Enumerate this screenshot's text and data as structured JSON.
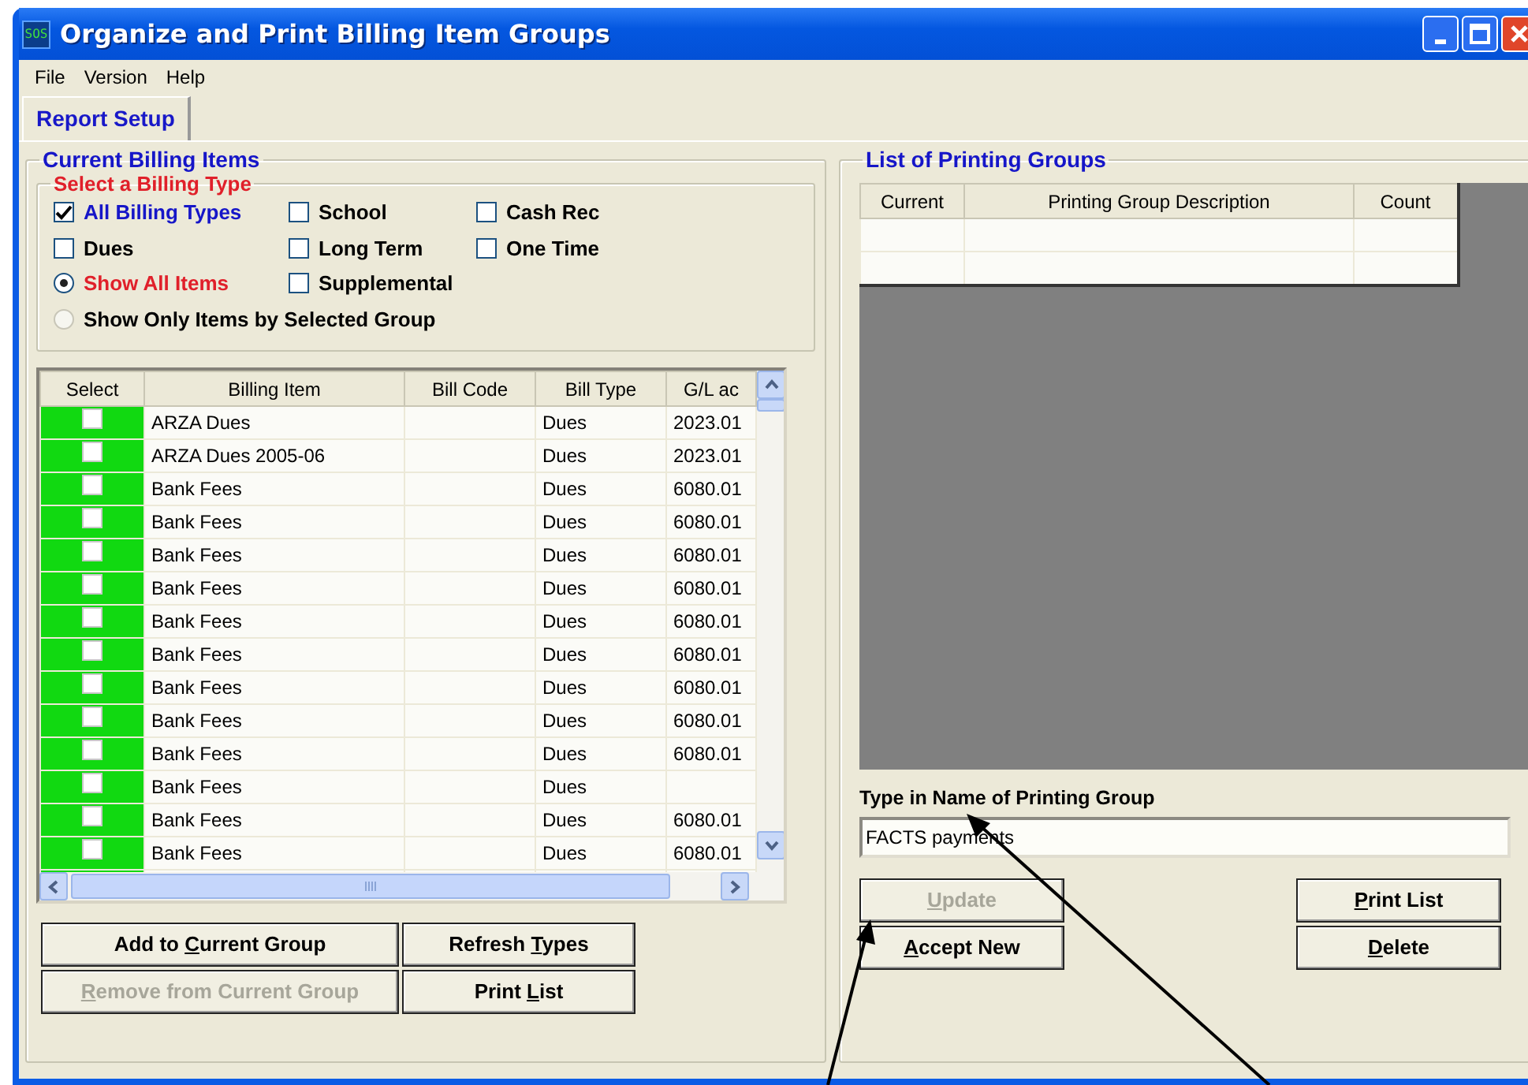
{
  "window": {
    "icon_label": "SOS",
    "title": "Organize and Print Billing Item Groups"
  },
  "menu": [
    "File",
    "Version",
    "Help"
  ],
  "tabs": [
    {
      "label": "Report Setup",
      "selected": true
    }
  ],
  "billing_items": {
    "title": "Current Billing Items",
    "billing_type": {
      "title": "Select a Billing Type",
      "options": [
        {
          "kind": "checkbox",
          "label": "All Billing Types",
          "checked": true
        },
        {
          "kind": "checkbox",
          "label": "School",
          "checked": false
        },
        {
          "kind": "checkbox",
          "label": "Cash Rec",
          "checked": false
        },
        {
          "kind": "checkbox",
          "label": "Dues",
          "checked": false
        },
        {
          "kind": "checkbox",
          "label": "Long Term",
          "checked": false
        },
        {
          "kind": "checkbox",
          "label": "One Time",
          "checked": false
        },
        {
          "kind": "radio",
          "label": "Show All Items",
          "selected": true
        },
        {
          "kind": "checkbox",
          "label": "Supplemental",
          "checked": false
        },
        {
          "kind": "radio",
          "label": "Show Only Items by Selected Group",
          "selected": false
        }
      ]
    },
    "table": {
      "columns": [
        "Select",
        "Billing Item",
        "Bill Code",
        "Bill Type",
        "G/L ac"
      ],
      "rows": [
        {
          "checked": false,
          "billing_item": "ARZA Dues",
          "bill_code": "",
          "bill_type": "Dues",
          "gl": "2023.01"
        },
        {
          "checked": false,
          "billing_item": "ARZA Dues 2005-06",
          "bill_code": "",
          "bill_type": "Dues",
          "gl": "2023.01"
        },
        {
          "checked": false,
          "billing_item": "Bank Fees",
          "bill_code": "",
          "bill_type": "Dues",
          "gl": "6080.01"
        },
        {
          "checked": false,
          "billing_item": "Bank Fees",
          "bill_code": "",
          "bill_type": "Dues",
          "gl": "6080.01"
        },
        {
          "checked": false,
          "billing_item": "Bank Fees",
          "bill_code": "",
          "bill_type": "Dues",
          "gl": "6080.01"
        },
        {
          "checked": false,
          "billing_item": "Bank Fees",
          "bill_code": "",
          "bill_type": "Dues",
          "gl": "6080.01"
        },
        {
          "checked": false,
          "billing_item": "Bank Fees",
          "bill_code": "",
          "bill_type": "Dues",
          "gl": "6080.01"
        },
        {
          "checked": false,
          "billing_item": "Bank Fees",
          "bill_code": "",
          "bill_type": "Dues",
          "gl": "6080.01"
        },
        {
          "checked": false,
          "billing_item": "Bank Fees",
          "bill_code": "",
          "bill_type": "Dues",
          "gl": "6080.01"
        },
        {
          "checked": false,
          "billing_item": "Bank Fees",
          "bill_code": "",
          "bill_type": "Dues",
          "gl": "6080.01"
        },
        {
          "checked": false,
          "billing_item": "Bank Fees",
          "bill_code": "",
          "bill_type": "Dues",
          "gl": "6080.01"
        },
        {
          "checked": false,
          "billing_item": "Bank Fees",
          "bill_code": "",
          "bill_type": "Dues",
          "gl": ""
        },
        {
          "checked": false,
          "billing_item": "Bank Fees",
          "bill_code": "",
          "bill_type": "Dues",
          "gl": "6080.01"
        },
        {
          "checked": false,
          "billing_item": "Bank Fees",
          "bill_code": "",
          "bill_type": "Dues",
          "gl": "6080.01"
        }
      ]
    },
    "buttons": [
      {
        "label_start": "Add to ",
        "access_key": "C",
        "label_end": "urrent Group",
        "disabled": false
      },
      {
        "label_start": "Refresh ",
        "access_key": "T",
        "label_end": "ypes",
        "disabled": false
      },
      {
        "access_key": "R",
        "label_end": "emove from Current Group",
        "disabled": true
      },
      {
        "label_start": "Print ",
        "access_key": "L",
        "label_end": "ist",
        "disabled": false
      }
    ]
  },
  "printing_groups": {
    "title": "List of Printing Groups",
    "table": {
      "columns": [
        "Current",
        "Printing Group Description",
        "Count"
      ]
    },
    "name_field": {
      "label": "Type in Name of Printing Group",
      "value": "FACTS payments"
    },
    "buttons_left": [
      {
        "access_key": "U",
        "label_end": "pdate",
        "disabled": true
      },
      {
        "access_key": "A",
        "label_end": "ccept New",
        "disabled": false
      }
    ],
    "buttons_right": [
      {
        "access_key": "P",
        "label_end": "rint List",
        "disabled": false
      },
      {
        "access_key": "D",
        "label_end": "elete",
        "disabled": false
      }
    ]
  }
}
